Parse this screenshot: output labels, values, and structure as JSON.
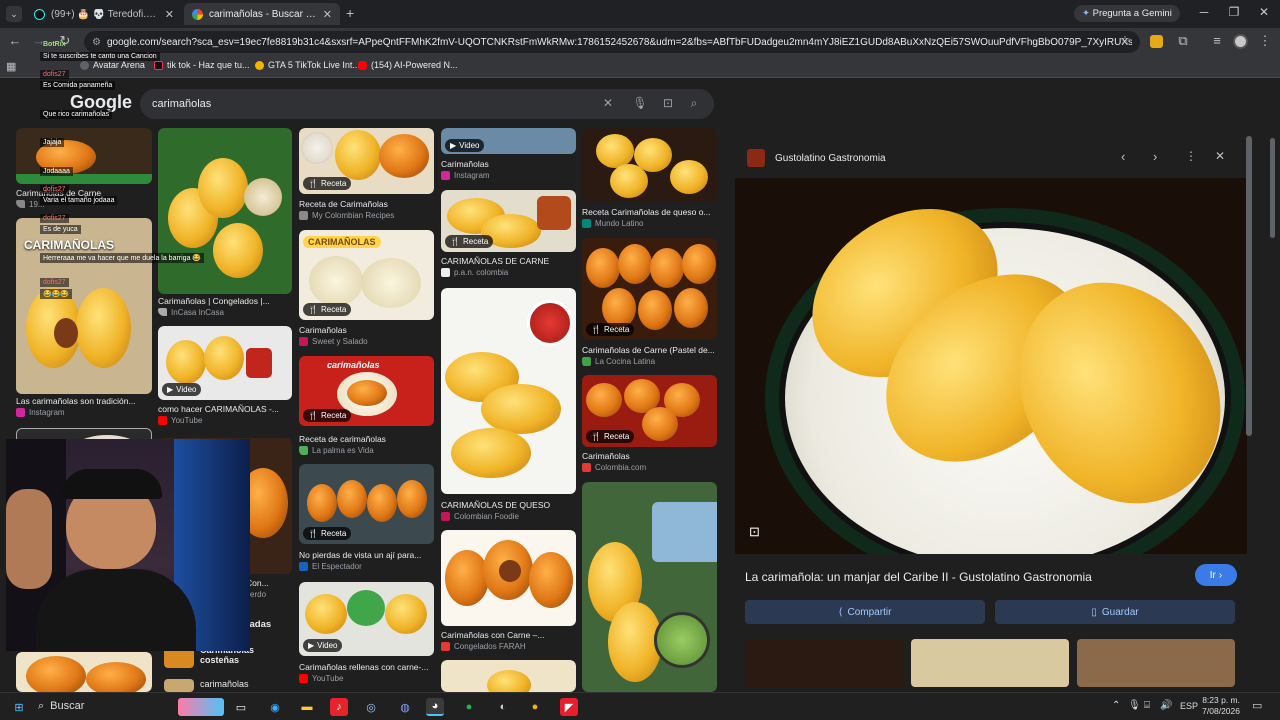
{
  "browser": {
    "tabs": [
      {
        "title": "(99+) 🎂 💀 Teredofi.507🇵🇦 🚾",
        "active": false
      },
      {
        "title": "carimañolas - Buscar con Goog",
        "active": true
      }
    ],
    "new_tab": "+",
    "gemini_button": "Pregunta a Gemini",
    "url": "google.com/search?sca_esv=19ec7fe8819b31c4&sxsrf=APpeQntFFMhK2fmV-UQOTCNKRstFmWkRMw:1786152452678&udm=2&fbs=ABfTbFUDadgeu2mn4mYJ8iEZ1GUDd8ABuXxNzQEi57SWOuuPdfVFhgBbO079P_7XyIRUXsGD3WYkjpd1kQ...",
    "bookmarks": [
      "Avatar Arena",
      "tik tok - Haz que tu...",
      "GTA 5 TikTok Live Int...",
      "(154) AI-Powered N..."
    ]
  },
  "search": {
    "query": "carimañolas",
    "logo": "Google"
  },
  "results": {
    "col1": [
      {
        "title": "Carimañolas de Carne",
        "source": "19..."
      },
      {
        "title": "Las carimañolas son tradición...",
        "source": "Instagram",
        "overlay": "CARIMAÑOLAS"
      }
    ],
    "col2": [
      {
        "title": "Carimañolas | Congelados |...",
        "source": "InCasa InCasa"
      },
      {
        "title": "como hacer CARIMAÑOLAS -...",
        "source": "YouTube",
        "badge": "Video"
      },
      {
        "title": "Con...",
        "source": "cerdo"
      }
    ],
    "col3": [
      {
        "title": "Receta de Carimañolas",
        "source": "My Colombian Recipes",
        "badge": "Receta"
      },
      {
        "title": "Carimañolas",
        "source": "Sweet y Salado",
        "badge": "Receta",
        "overlay": "CARIMAÑOLAS"
      },
      {
        "title": "Receta de carimañolas",
        "source": "La palma es Vida",
        "badge": "Receta",
        "overlay": "carimañolas"
      },
      {
        "title": "No pierdas de vista un ají para...",
        "source": "El Espectador",
        "badge": "Receta"
      },
      {
        "title": "Carimañolas rellenas con carne-...",
        "source": "YouTube",
        "badge": "Video"
      }
    ],
    "col4": [
      {
        "title": "Carimañolas",
        "source": "Instagram",
        "badge": "Video"
      },
      {
        "title": "CARIMAÑOLAS DE CARNE",
        "source": "p.a.n. colombia",
        "badge": "Receta"
      },
      {
        "title": "CARIMAÑOLAS DE QUESO",
        "source": "Colombian Foodie"
      },
      {
        "title": "Carimañolas con Carne –...",
        "source": "Congelados FARAH"
      }
    ],
    "col5": [
      {
        "title": "Receta Carimañolas de queso o...",
        "source": "Mundo Latino"
      },
      {
        "title": "Carimañolas de Carne (Pastel de...",
        "source": "La Cocina Latina",
        "badge": "Receta"
      },
      {
        "title": "Carimañolas",
        "source": "Colombia.com",
        "badge": "Receta"
      }
    ],
    "related": [
      {
        "label": "Carimañolas costeñas"
      },
      {
        "label": "carimañolas"
      }
    ],
    "related_header": "...onadas"
  },
  "panel": {
    "source_name": "Gustolatino Gastronomia",
    "title": "La carimañola: un manjar del Caribe II - Gustolatino Gastronomia",
    "visit_button": "Ir",
    "share_button": "Compartir",
    "save_button": "Guardar"
  },
  "chat": {
    "bot_name": "BotRix",
    "messages": [
      "Si te suscribes te canto una Cancion",
      "dofis27",
      "Es Comida panameña",
      "Que rico carimañolas",
      "Jajaja",
      "Jodaaaa",
      "dofis27",
      "Varia el tamaño jodaaa",
      "dofis27",
      "Es de yuca",
      "Herreraaa me va hacer que me duela la barriga 😂",
      "dofis27",
      "😂😂😂"
    ]
  },
  "taskbar": {
    "search_label": "Buscar",
    "time": "8:23 p. m.",
    "date": "7/08/2026",
    "lang": "ESP"
  },
  "colors": {
    "accent": "#a8c7fa",
    "panel_button": "#2b3a52",
    "visit_button": "#3b7be8"
  }
}
